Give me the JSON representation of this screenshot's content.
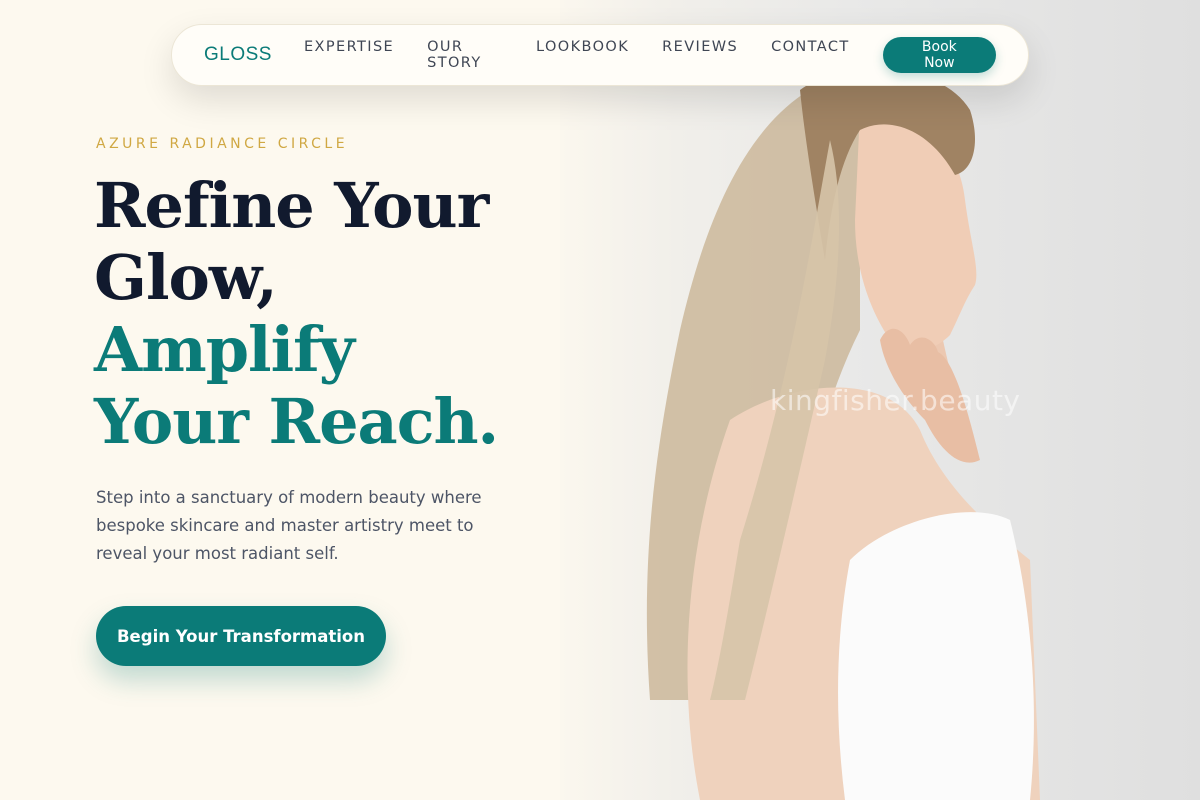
{
  "nav": {
    "brand": "GLOSS",
    "links": [
      "EXPERTISE",
      "OUR STORY",
      "LOOKBOOK",
      "REVIEWS",
      "CONTACT"
    ],
    "cta": "Book Now"
  },
  "hero": {
    "eyebrow": "AZURE RADIANCE CIRCLE",
    "headline_line1": "Refine Your",
    "headline_line2": "Glow,",
    "headline_line3": "Amplify",
    "headline_line4": "Your Reach.",
    "description": "Step into a sanctuary of modern beauty where bespoke skincare and master artistry meet to reveal your most radiant self.",
    "cta": "Begin Your Transformation"
  },
  "photo": {
    "watermark": "kingfisher.beauty",
    "subject": "woman-profile-photo"
  },
  "colors": {
    "accent": "#0b7b78",
    "gold": "#d0a843",
    "heading": "#111a2e",
    "background": "#fdf9ef"
  }
}
